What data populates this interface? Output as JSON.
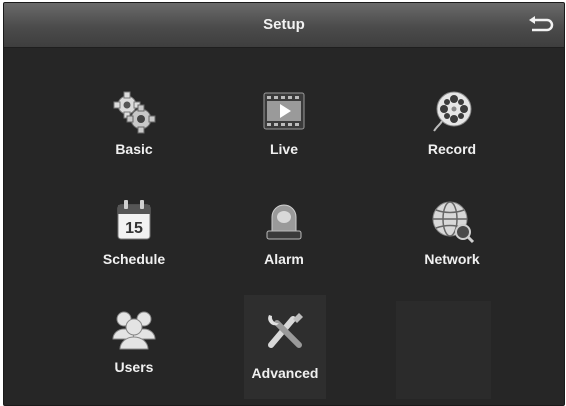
{
  "header": {
    "title": "Setup",
    "back_icon": "back-arrow-icon"
  },
  "menu": {
    "items": [
      {
        "label": "Basic",
        "icon": "gears-icon"
      },
      {
        "label": "Live",
        "icon": "film-play-icon"
      },
      {
        "label": "Record",
        "icon": "film-reel-icon"
      },
      {
        "label": "Schedule",
        "icon": "calendar-icon",
        "day": "15"
      },
      {
        "label": "Alarm",
        "icon": "siren-icon"
      },
      {
        "label": "Network",
        "icon": "globe-icon"
      },
      {
        "label": "Users",
        "icon": "users-icon"
      },
      {
        "label": "Advanced",
        "icon": "tools-icon",
        "selected": true
      }
    ]
  },
  "colors": {
    "background": "#262626",
    "titlebar": "#5a5a5a",
    "text": "#f0f0f0"
  }
}
